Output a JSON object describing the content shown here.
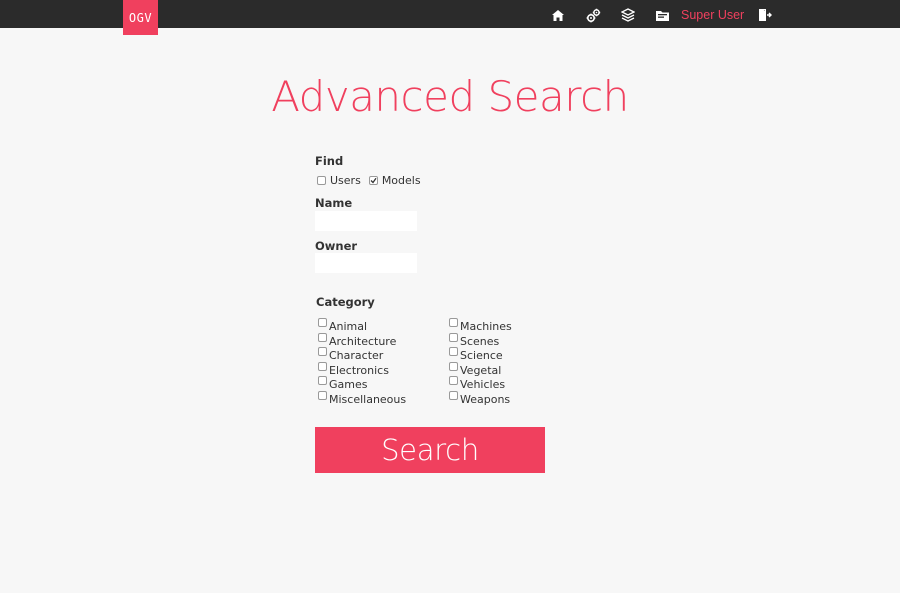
{
  "app": {
    "logo_text": "OGV",
    "brand_color": "#f0405e"
  },
  "navbar": {
    "icons": [
      "home-icon",
      "settings-gears-icon",
      "layers-icon",
      "folder-icon"
    ],
    "user_name": "Super User",
    "logout_icon": "logout-icon"
  },
  "page": {
    "title": "Advanced Search"
  },
  "form": {
    "find_label": "Find",
    "find_options": [
      {
        "label": "Users",
        "checked": false
      },
      {
        "label": "Models",
        "checked": true
      }
    ],
    "name_label": "Name",
    "name_value": "",
    "owner_label": "Owner",
    "owner_value": "",
    "category_label": "Category",
    "categories_left": [
      "Animal",
      "Architecture",
      "Character",
      "Electronics",
      "Games",
      "Miscellaneous"
    ],
    "categories_right": [
      "Machines",
      "Scenes",
      "Science",
      "Vegetal",
      "Vehicles",
      "Weapons"
    ],
    "search_label": "Search"
  }
}
